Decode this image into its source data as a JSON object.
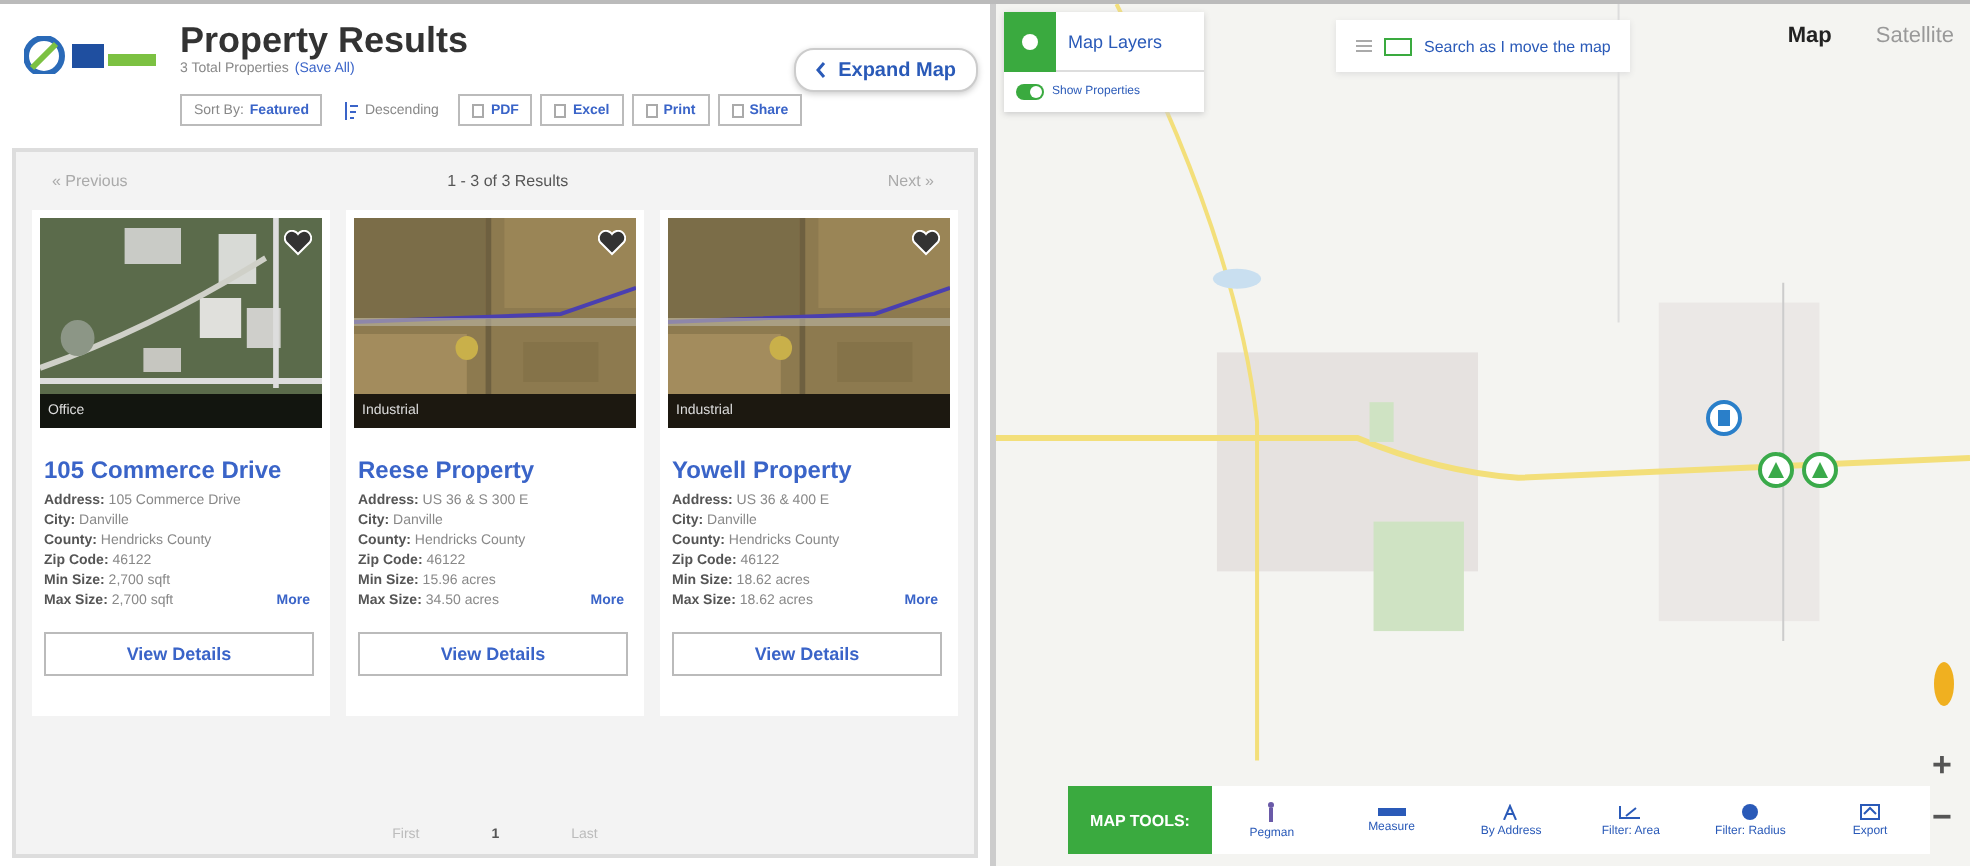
{
  "header": {
    "title": "Property Results",
    "subtitle": "3 Total Properties",
    "save_link": "(Save All)",
    "expand_button": "Expand Map",
    "sort": {
      "label": "Sort By:",
      "value": "Featured"
    },
    "order": "Descending",
    "actions": [
      "PDF",
      "Excel",
      "Print",
      "Share"
    ]
  },
  "results": {
    "previous": "« Previous",
    "count": "1 - 3 of 3 Results",
    "next": "Next »"
  },
  "properties": [
    {
      "type": "Office",
      "name": "105 Commerce Drive",
      "fields": [
        {
          "label": "Address:",
          "value": "105 Commerce Drive"
        },
        {
          "label": "City:",
          "value": "Danville"
        },
        {
          "label": "County:",
          "value": "Hendricks County"
        },
        {
          "label": "Zip Code:",
          "value": "46122"
        },
        {
          "label": "Min Size:",
          "value": "2,700 sqft"
        },
        {
          "label": "Max Size:",
          "value": "2,700 sqft"
        }
      ],
      "more": "More",
      "button": "View Details"
    },
    {
      "type": "Industrial",
      "name": "Reese Property",
      "fields": [
        {
          "label": "Address:",
          "value": "US 36 & S 300 E"
        },
        {
          "label": "City:",
          "value": "Danville"
        },
        {
          "label": "County:",
          "value": "Hendricks County"
        },
        {
          "label": "Zip Code:",
          "value": "46122"
        },
        {
          "label": "Min Size:",
          "value": "15.96 acres"
        },
        {
          "label": "Max Size:",
          "value": "34.50 acres"
        }
      ],
      "more": "More",
      "button": "View Details"
    },
    {
      "type": "Industrial",
      "name": "Yowell Property",
      "fields": [
        {
          "label": "Address:",
          "value": "US 36 & 400 E"
        },
        {
          "label": "City:",
          "value": "Danville"
        },
        {
          "label": "County:",
          "value": "Hendricks County"
        },
        {
          "label": "Zip Code:",
          "value": "46122"
        },
        {
          "label": "Min Size:",
          "value": "18.62 acres"
        },
        {
          "label": "Max Size:",
          "value": "18.62 acres"
        }
      ],
      "more": "More",
      "button": "View Details"
    }
  ],
  "pagination": [
    {
      "label": "First",
      "selected": false
    },
    {
      "label": "1",
      "selected": true
    },
    {
      "label": "Last",
      "selected": false
    }
  ],
  "map": {
    "layers": "Map Layers",
    "show_properties": {
      "label": "Show Properties",
      "on": true
    },
    "search_move": {
      "label": "Search as I move the map",
      "checked": false
    },
    "types": [
      {
        "label": "Map",
        "selected": true
      },
      {
        "label": "Satellite",
        "selected": false
      }
    ],
    "markers": [
      {
        "kind": "office",
        "color": "#2a7fc9"
      },
      {
        "kind": "industrial",
        "color": "#3aaa4a"
      },
      {
        "kind": "industrial",
        "color": "#3aaa4a"
      }
    ],
    "tools_label": "MAP TOOLS:",
    "tools": [
      {
        "kind": "pegman",
        "label": "Pegman"
      },
      {
        "kind": "measure",
        "label": "Measure"
      },
      {
        "kind": "address",
        "label": "By Address"
      },
      {
        "kind": "area",
        "label": "Filter: Area"
      },
      {
        "kind": "radius",
        "label": "Filter: Radius"
      },
      {
        "kind": "export",
        "label": "Export"
      }
    ],
    "zoom": [
      "+",
      "−"
    ]
  }
}
